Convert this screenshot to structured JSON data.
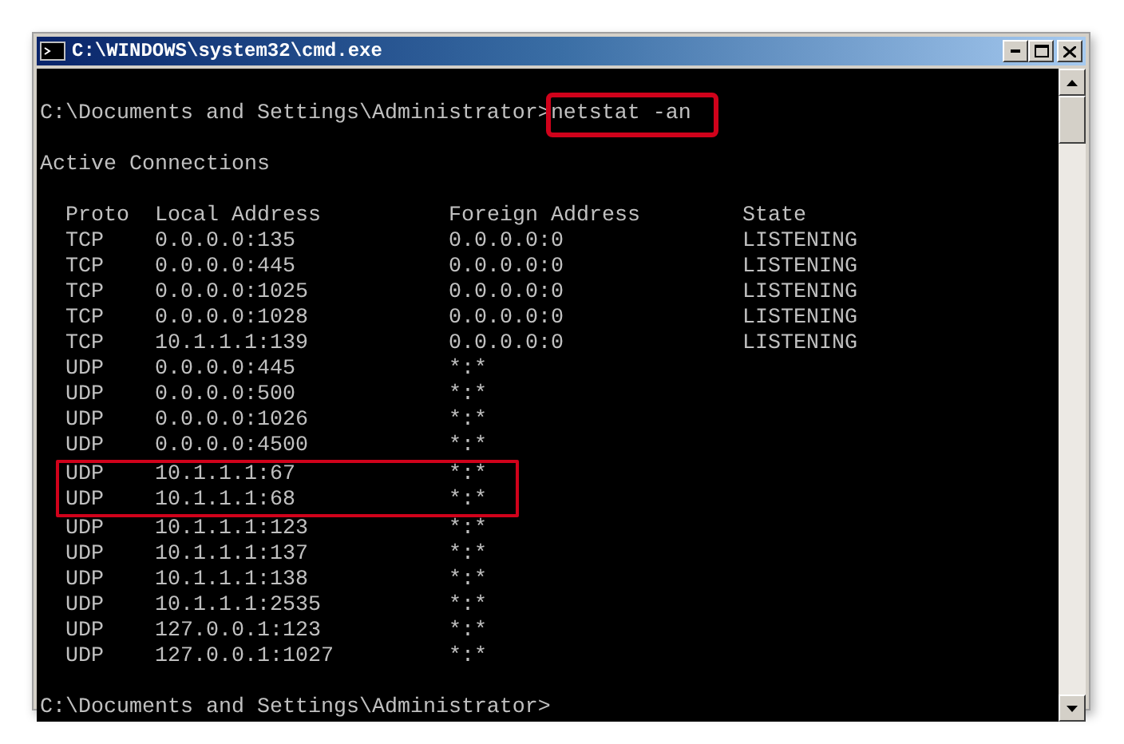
{
  "window": {
    "title": "C:\\WINDOWS\\system32\\cmd.exe"
  },
  "console": {
    "prompt": "C:\\Documents and Settings\\Administrator>",
    "command": {
      "text": "netstat -an",
      "highlighted": true
    },
    "heading": "Active Connections",
    "columns": [
      "Proto",
      "Local Address",
      "Foreign Address",
      "State"
    ],
    "rows": [
      {
        "proto": "TCP",
        "local": "0.0.0.0:135",
        "foreign": "0.0.0.0:0",
        "state": "LISTENING",
        "highlighted": false
      },
      {
        "proto": "TCP",
        "local": "0.0.0.0:445",
        "foreign": "0.0.0.0:0",
        "state": "LISTENING",
        "highlighted": false
      },
      {
        "proto": "TCP",
        "local": "0.0.0.0:1025",
        "foreign": "0.0.0.0:0",
        "state": "LISTENING",
        "highlighted": false
      },
      {
        "proto": "TCP",
        "local": "0.0.0.0:1028",
        "foreign": "0.0.0.0:0",
        "state": "LISTENING",
        "highlighted": false
      },
      {
        "proto": "TCP",
        "local": "10.1.1.1:139",
        "foreign": "0.0.0.0:0",
        "state": "LISTENING",
        "highlighted": false
      },
      {
        "proto": "UDP",
        "local": "0.0.0.0:445",
        "foreign": "*:*",
        "highlighted": false
      },
      {
        "proto": "UDP",
        "local": "0.0.0.0:500",
        "foreign": "*:*",
        "highlighted": false
      },
      {
        "proto": "UDP",
        "local": "0.0.0.0:1026",
        "foreign": "*:*",
        "highlighted": false
      },
      {
        "proto": "UDP",
        "local": "0.0.0.0:4500",
        "foreign": "*:*",
        "highlighted": false
      },
      {
        "proto": "UDP",
        "local": "10.1.1.1:67",
        "foreign": "*:*",
        "highlighted": true
      },
      {
        "proto": "UDP",
        "local": "10.1.1.1:68",
        "foreign": "*:*",
        "highlighted": true
      },
      {
        "proto": "UDP",
        "local": "10.1.1.1:123",
        "foreign": "*:*",
        "highlighted": false
      },
      {
        "proto": "UDP",
        "local": "10.1.1.1:137",
        "foreign": "*:*",
        "highlighted": false
      },
      {
        "proto": "UDP",
        "local": "10.1.1.1:138",
        "foreign": "*:*",
        "highlighted": false
      },
      {
        "proto": "UDP",
        "local": "10.1.1.1:2535",
        "foreign": "*:*",
        "highlighted": false
      },
      {
        "proto": "UDP",
        "local": "127.0.0.1:123",
        "foreign": "*:*",
        "highlighted": false
      },
      {
        "proto": "UDP",
        "local": "127.0.0.1:1027",
        "foreign": "*:*",
        "highlighted": false
      }
    ],
    "final_prompt": "C:\\Documents and Settings\\Administrator>"
  }
}
